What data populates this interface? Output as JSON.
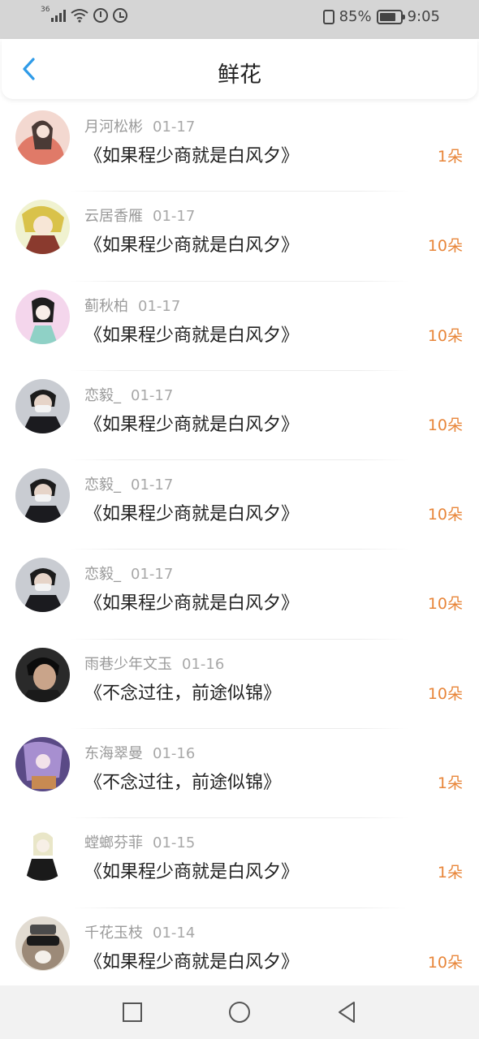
{
  "status_bar": {
    "network": "36",
    "battery": "85%",
    "time": "9:05"
  },
  "header": {
    "title": "鲜花"
  },
  "colors": {
    "accent_orange": "#e8863a",
    "back_blue": "#2f9be8"
  },
  "items": [
    {
      "name": "月河松彬",
      "date": "01-17",
      "book": "《如果程少商就是白风夕》",
      "count": "1朵",
      "avatar": "avatar-anime-girl-red"
    },
    {
      "name": "云居香雁",
      "date": "01-17",
      "book": "《如果程少商就是白风夕》",
      "count": "10朵",
      "avatar": "avatar-anime-boy-yellow"
    },
    {
      "name": "蓟秋柏",
      "date": "01-17",
      "book": "《如果程少商就是白风夕》",
      "count": "10朵",
      "avatar": "avatar-anime-girl-pink"
    },
    {
      "name": "恋毅_",
      "date": "01-17",
      "book": "《如果程少商就是白风夕》",
      "count": "10朵",
      "avatar": "avatar-masked-man"
    },
    {
      "name": "恋毅_",
      "date": "01-17",
      "book": "《如果程少商就是白风夕》",
      "count": "10朵",
      "avatar": "avatar-masked-man"
    },
    {
      "name": "恋毅_",
      "date": "01-17",
      "book": "《如果程少商就是白风夕》",
      "count": "10朵",
      "avatar": "avatar-masked-man"
    },
    {
      "name": "雨巷少年文玉",
      "date": "01-16",
      "book": "《不念过往，前途似锦》",
      "count": "10朵",
      "avatar": "avatar-young-man"
    },
    {
      "name": "东海翠曼",
      "date": "01-16",
      "book": "《不念过往，前途似锦》",
      "count": "1朵",
      "avatar": "avatar-anime-purple"
    },
    {
      "name": "螳螂芬菲",
      "date": "01-15",
      "book": "《如果程少商就是白风夕》",
      "count": "1朵",
      "avatar": "avatar-sketch-person"
    },
    {
      "name": "千花玉枝",
      "date": "01-14",
      "book": "《如果程少商就是白风夕》",
      "count": "10朵",
      "avatar": "avatar-dog-sunglasses"
    }
  ]
}
